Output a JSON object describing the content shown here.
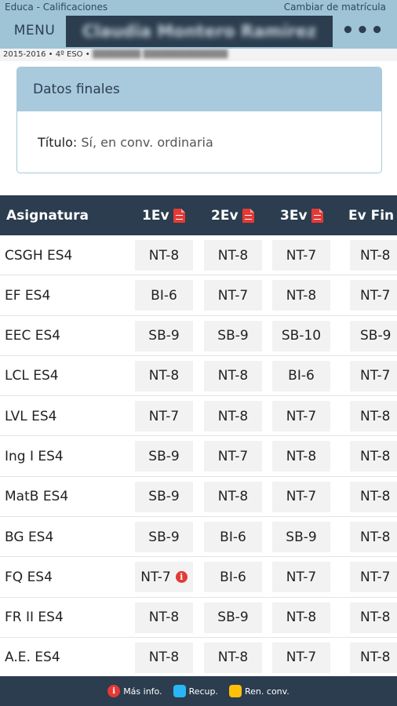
{
  "header": {
    "app_title": "Educa - Calificaciones",
    "change_label": "Cambiar de matrícula",
    "menu_label": "MENU",
    "student_name": "Claudia Montero Ramírez",
    "more_label": "•••"
  },
  "year_line": "2015-2016 • 4º ESO •",
  "final_card": {
    "title": "Datos finales",
    "label": "Título:",
    "value": "Sí, en conv. ordinaria"
  },
  "table": {
    "headers": [
      "Asignatura",
      "1Ev",
      "2Ev",
      "3Ev",
      "Ev Fin"
    ],
    "rows": [
      {
        "subject": "CSGH ES4",
        "e1": "NT-8",
        "e2": "NT-8",
        "e3": "NT-7",
        "fin": "NT-8"
      },
      {
        "subject": "EF ES4",
        "e1": "BI-6",
        "e2": "NT-7",
        "e3": "NT-8",
        "fin": "NT-7"
      },
      {
        "subject": "EEC ES4",
        "e1": "SB-9",
        "e2": "SB-9",
        "e3": "SB-10",
        "fin": "SB-9"
      },
      {
        "subject": "LCL ES4",
        "e1": "NT-8",
        "e2": "NT-8",
        "e3": "BI-6",
        "fin": "NT-7"
      },
      {
        "subject": "LVL ES4",
        "e1": "NT-7",
        "e2": "NT-8",
        "e3": "NT-7",
        "fin": "NT-8"
      },
      {
        "subject": "Ing I ES4",
        "e1": "SB-9",
        "e2": "NT-7",
        "e3": "NT-8",
        "fin": "NT-8"
      },
      {
        "subject": "MatB ES4",
        "e1": "SB-9",
        "e2": "NT-8",
        "e3": "NT-7",
        "fin": "NT-8"
      },
      {
        "subject": "BG ES4",
        "e1": "SB-9",
        "e2": "BI-6",
        "e3": "SB-9",
        "fin": "NT-8"
      },
      {
        "subject": "FQ ES4",
        "e1": "NT-7",
        "e1_info": true,
        "e2": "BI-6",
        "e3": "NT-7",
        "fin": "NT-7"
      },
      {
        "subject": "FR II ES4",
        "e1": "NT-8",
        "e2": "SB-9",
        "e3": "NT-8",
        "fin": "NT-8"
      },
      {
        "subject": "A.E. ES4",
        "e1": "NT-8",
        "e2": "NT-8",
        "e3": "NT-7",
        "fin": "NT-8"
      }
    ]
  },
  "legend": {
    "info_label": "Más info.",
    "recup_label": "Recup.",
    "ren_label": "Ren. conv."
  },
  "icons": {
    "report": "pdf-report-icon",
    "info": "info-icon"
  },
  "colors": {
    "header_bg": "#9ec4d6",
    "dark_bar": "#2b3d4f",
    "info_red": "#e53935",
    "recup_blue": "#29b6f6",
    "ren_yellow": "#ffc107"
  }
}
